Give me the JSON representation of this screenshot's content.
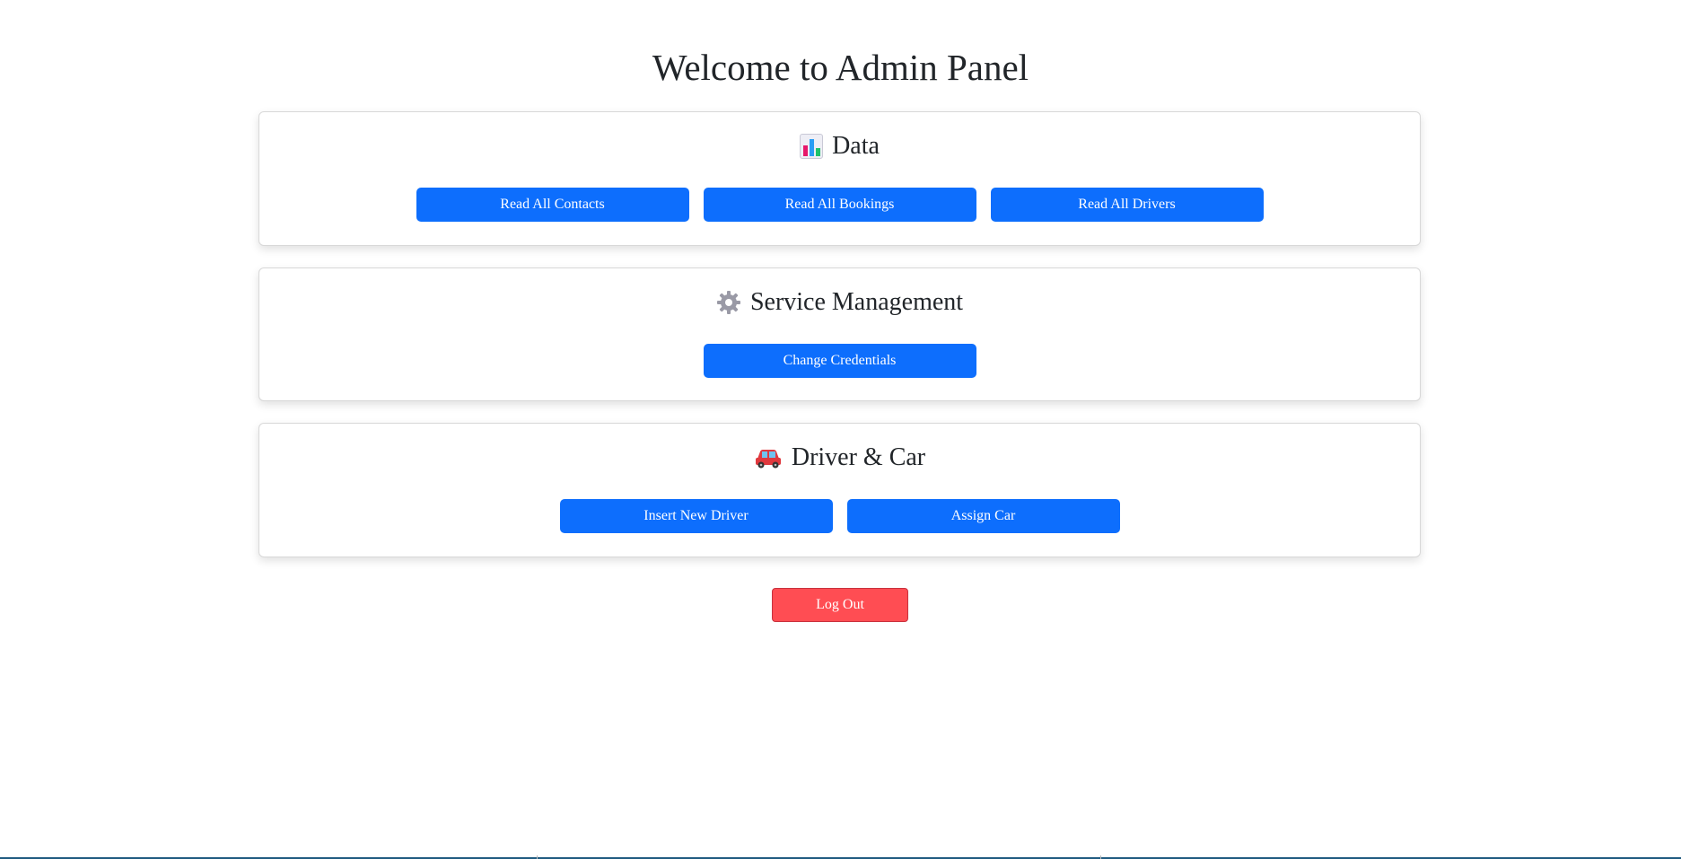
{
  "header": {
    "title": "Welcome to Admin Panel"
  },
  "sections": {
    "data": {
      "icon": "bar-chart-icon",
      "title": "Data",
      "buttons": [
        "Read All Contacts",
        "Read All Bookings",
        "Read All Drivers"
      ]
    },
    "service": {
      "icon": "gear-icon",
      "title": "Service Management",
      "buttons": [
        "Change Credentials"
      ]
    },
    "driver": {
      "icon": "car-icon",
      "title": "Driver & Car",
      "buttons": [
        "Insert New Driver",
        "Assign Car"
      ]
    }
  },
  "logout": {
    "label": "Log Out"
  },
  "colors": {
    "primary": "#0d6efd",
    "danger": "#ff4d53",
    "text": "#212529",
    "card_border": "#d8d8d8"
  }
}
